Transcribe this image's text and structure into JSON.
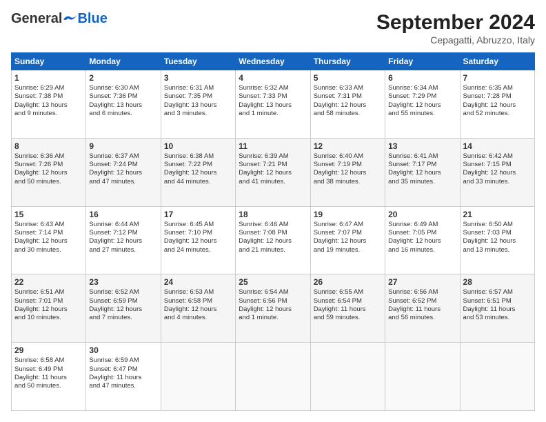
{
  "header": {
    "logo_general": "General",
    "logo_blue": "Blue",
    "month_title": "September 2024",
    "subtitle": "Cepagatti, Abruzzo, Italy"
  },
  "days_of_week": [
    "Sunday",
    "Monday",
    "Tuesday",
    "Wednesday",
    "Thursday",
    "Friday",
    "Saturday"
  ],
  "weeks": [
    [
      {
        "day": 1,
        "lines": [
          "Sunrise: 6:29 AM",
          "Sunset: 7:38 PM",
          "Daylight: 13 hours",
          "and 9 minutes."
        ]
      },
      {
        "day": 2,
        "lines": [
          "Sunrise: 6:30 AM",
          "Sunset: 7:36 PM",
          "Daylight: 13 hours",
          "and 6 minutes."
        ]
      },
      {
        "day": 3,
        "lines": [
          "Sunrise: 6:31 AM",
          "Sunset: 7:35 PM",
          "Daylight: 13 hours",
          "and 3 minutes."
        ]
      },
      {
        "day": 4,
        "lines": [
          "Sunrise: 6:32 AM",
          "Sunset: 7:33 PM",
          "Daylight: 13 hours",
          "and 1 minute."
        ]
      },
      {
        "day": 5,
        "lines": [
          "Sunrise: 6:33 AM",
          "Sunset: 7:31 PM",
          "Daylight: 12 hours",
          "and 58 minutes."
        ]
      },
      {
        "day": 6,
        "lines": [
          "Sunrise: 6:34 AM",
          "Sunset: 7:29 PM",
          "Daylight: 12 hours",
          "and 55 minutes."
        ]
      },
      {
        "day": 7,
        "lines": [
          "Sunrise: 6:35 AM",
          "Sunset: 7:28 PM",
          "Daylight: 12 hours",
          "and 52 minutes."
        ]
      }
    ],
    [
      {
        "day": 8,
        "lines": [
          "Sunrise: 6:36 AM",
          "Sunset: 7:26 PM",
          "Daylight: 12 hours",
          "and 50 minutes."
        ]
      },
      {
        "day": 9,
        "lines": [
          "Sunrise: 6:37 AM",
          "Sunset: 7:24 PM",
          "Daylight: 12 hours",
          "and 47 minutes."
        ]
      },
      {
        "day": 10,
        "lines": [
          "Sunrise: 6:38 AM",
          "Sunset: 7:22 PM",
          "Daylight: 12 hours",
          "and 44 minutes."
        ]
      },
      {
        "day": 11,
        "lines": [
          "Sunrise: 6:39 AM",
          "Sunset: 7:21 PM",
          "Daylight: 12 hours",
          "and 41 minutes."
        ]
      },
      {
        "day": 12,
        "lines": [
          "Sunrise: 6:40 AM",
          "Sunset: 7:19 PM",
          "Daylight: 12 hours",
          "and 38 minutes."
        ]
      },
      {
        "day": 13,
        "lines": [
          "Sunrise: 6:41 AM",
          "Sunset: 7:17 PM",
          "Daylight: 12 hours",
          "and 35 minutes."
        ]
      },
      {
        "day": 14,
        "lines": [
          "Sunrise: 6:42 AM",
          "Sunset: 7:15 PM",
          "Daylight: 12 hours",
          "and 33 minutes."
        ]
      }
    ],
    [
      {
        "day": 15,
        "lines": [
          "Sunrise: 6:43 AM",
          "Sunset: 7:14 PM",
          "Daylight: 12 hours",
          "and 30 minutes."
        ]
      },
      {
        "day": 16,
        "lines": [
          "Sunrise: 6:44 AM",
          "Sunset: 7:12 PM",
          "Daylight: 12 hours",
          "and 27 minutes."
        ]
      },
      {
        "day": 17,
        "lines": [
          "Sunrise: 6:45 AM",
          "Sunset: 7:10 PM",
          "Daylight: 12 hours",
          "and 24 minutes."
        ]
      },
      {
        "day": 18,
        "lines": [
          "Sunrise: 6:46 AM",
          "Sunset: 7:08 PM",
          "Daylight: 12 hours",
          "and 21 minutes."
        ]
      },
      {
        "day": 19,
        "lines": [
          "Sunrise: 6:47 AM",
          "Sunset: 7:07 PM",
          "Daylight: 12 hours",
          "and 19 minutes."
        ]
      },
      {
        "day": 20,
        "lines": [
          "Sunrise: 6:49 AM",
          "Sunset: 7:05 PM",
          "Daylight: 12 hours",
          "and 16 minutes."
        ]
      },
      {
        "day": 21,
        "lines": [
          "Sunrise: 6:50 AM",
          "Sunset: 7:03 PM",
          "Daylight: 12 hours",
          "and 13 minutes."
        ]
      }
    ],
    [
      {
        "day": 22,
        "lines": [
          "Sunrise: 6:51 AM",
          "Sunset: 7:01 PM",
          "Daylight: 12 hours",
          "and 10 minutes."
        ]
      },
      {
        "day": 23,
        "lines": [
          "Sunrise: 6:52 AM",
          "Sunset: 6:59 PM",
          "Daylight: 12 hours",
          "and 7 minutes."
        ]
      },
      {
        "day": 24,
        "lines": [
          "Sunrise: 6:53 AM",
          "Sunset: 6:58 PM",
          "Daylight: 12 hours",
          "and 4 minutes."
        ]
      },
      {
        "day": 25,
        "lines": [
          "Sunrise: 6:54 AM",
          "Sunset: 6:56 PM",
          "Daylight: 12 hours",
          "and 1 minute."
        ]
      },
      {
        "day": 26,
        "lines": [
          "Sunrise: 6:55 AM",
          "Sunset: 6:54 PM",
          "Daylight: 11 hours",
          "and 59 minutes."
        ]
      },
      {
        "day": 27,
        "lines": [
          "Sunrise: 6:56 AM",
          "Sunset: 6:52 PM",
          "Daylight: 11 hours",
          "and 56 minutes."
        ]
      },
      {
        "day": 28,
        "lines": [
          "Sunrise: 6:57 AM",
          "Sunset: 6:51 PM",
          "Daylight: 11 hours",
          "and 53 minutes."
        ]
      }
    ],
    [
      {
        "day": 29,
        "lines": [
          "Sunrise: 6:58 AM",
          "Sunset: 6:49 PM",
          "Daylight: 11 hours",
          "and 50 minutes."
        ]
      },
      {
        "day": 30,
        "lines": [
          "Sunrise: 6:59 AM",
          "Sunset: 6:47 PM",
          "Daylight: 11 hours",
          "and 47 minutes."
        ]
      },
      null,
      null,
      null,
      null,
      null
    ]
  ]
}
